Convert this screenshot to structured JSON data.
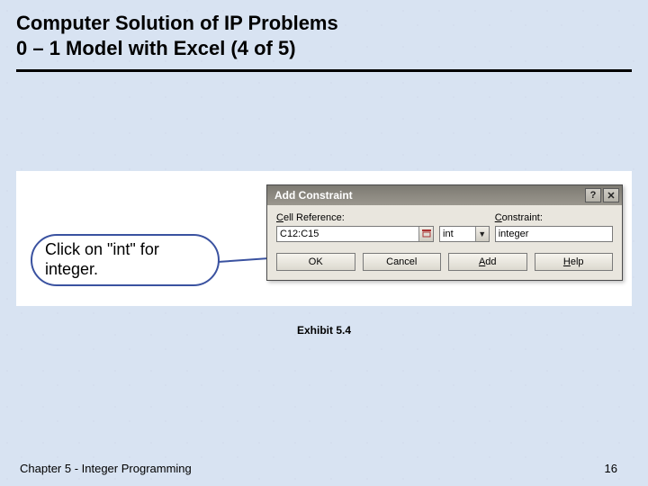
{
  "title": {
    "line1": "Computer Solution of IP Problems",
    "line2": "0 – 1 Model with Excel (4 of 5)"
  },
  "callout": "Click on \"int\" for integer.",
  "dialog": {
    "title": "Add Constraint",
    "help_btn": "?",
    "close_btn": "✕",
    "cell_ref_label_pre": "C",
    "cell_ref_label_rest": "ell Reference:",
    "cell_ref_value": "C12:C15",
    "operator_value": "int",
    "constraint_label_pre": "C",
    "constraint_label_rest": "onstraint:",
    "constraint_value": "integer",
    "buttons": {
      "ok": "OK",
      "cancel": "Cancel",
      "add_pre": "A",
      "add_rest": "dd",
      "help_pre": "H",
      "help_rest": "elp"
    }
  },
  "exhibit": "Exhibit 5.4",
  "footer": {
    "left": "Chapter 5 - Integer Programming",
    "right": "16"
  }
}
